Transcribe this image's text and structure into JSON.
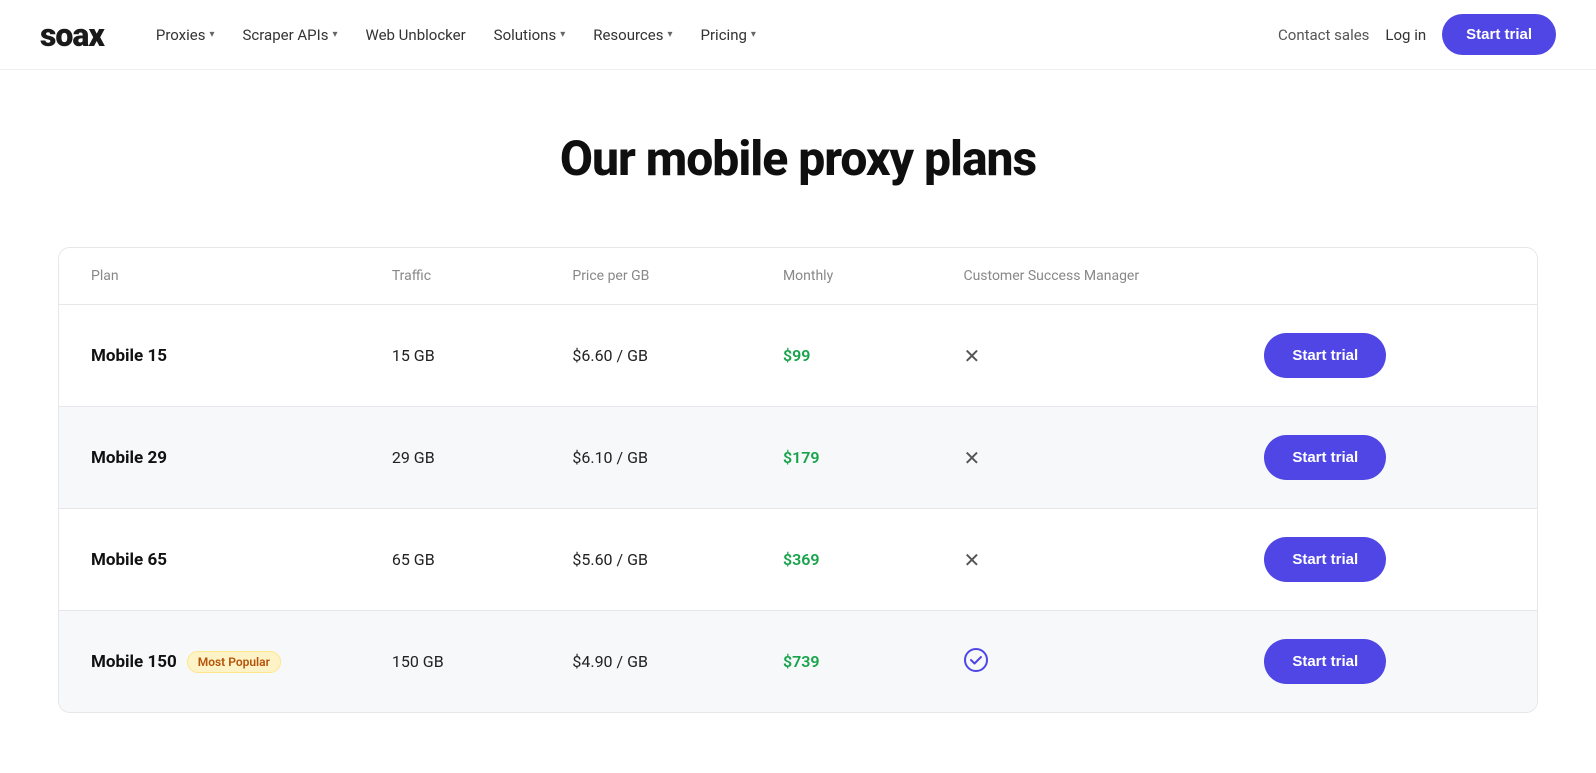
{
  "logo": "soax",
  "nav": {
    "items": [
      {
        "label": "Proxies",
        "has_dropdown": true
      },
      {
        "label": "Scraper APIs",
        "has_dropdown": true
      },
      {
        "label": "Web Unblocker",
        "has_dropdown": false
      },
      {
        "label": "Solutions",
        "has_dropdown": true
      },
      {
        "label": "Resources",
        "has_dropdown": true
      },
      {
        "label": "Pricing",
        "has_dropdown": true
      }
    ],
    "contact_sales": "Contact sales",
    "login": "Log in",
    "start_trial": "Start trial"
  },
  "hero": {
    "title": "Our mobile proxy plans"
  },
  "table": {
    "headers": [
      "Plan",
      "Traffic",
      "Price per GB",
      "Monthly",
      "Customer Success Manager",
      ""
    ],
    "rows": [
      {
        "plan": "Mobile 15",
        "badge": null,
        "traffic": "15 GB",
        "price_per_gb": "$6.60 / GB",
        "monthly": "$99",
        "csm": "x",
        "highlighted": false
      },
      {
        "plan": "Mobile 29",
        "badge": null,
        "traffic": "29 GB",
        "price_per_gb": "$6.10 / GB",
        "monthly": "$179",
        "csm": "x",
        "highlighted": true
      },
      {
        "plan": "Mobile 65",
        "badge": null,
        "traffic": "65 GB",
        "price_per_gb": "$5.60 / GB",
        "monthly": "$369",
        "csm": "x",
        "highlighted": false
      },
      {
        "plan": "Mobile 150",
        "badge": "Most Popular",
        "traffic": "150 GB",
        "price_per_gb": "$4.90 / GB",
        "monthly": "$739",
        "csm": "check",
        "highlighted": true
      }
    ],
    "start_trial_label": "Start trial"
  }
}
